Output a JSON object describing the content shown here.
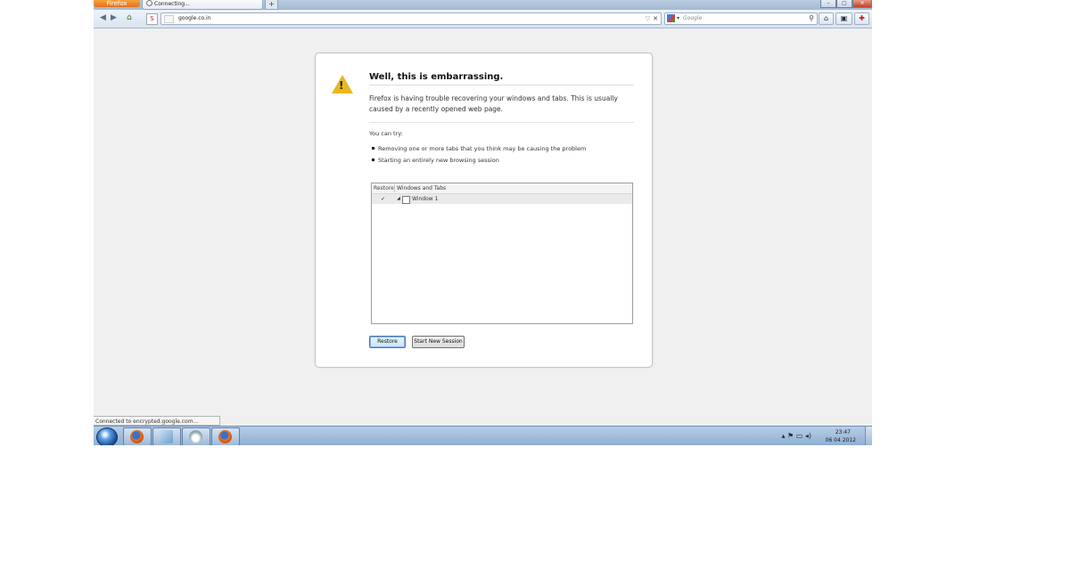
{
  "browser": {
    "menu_button": "Firefox",
    "tab_title": "Connecting...",
    "new_tab": "+",
    "window_controls": {
      "minimize": "–",
      "maximize": "▢",
      "close": "✕"
    }
  },
  "navbar": {
    "url": "google.co.in",
    "search_placeholder": "Google",
    "icons": [
      "back-icon",
      "forward-icon",
      "home-icon",
      "search-icon"
    ]
  },
  "dialog": {
    "title": "Well, this is embarrassing.",
    "message": "Firefox is having trouble recovering your windows and tabs. This is usually caused by a recently opened web page.",
    "you_can_try": "You can try:",
    "suggestions": [
      "Removing one or more tabs that you think may be causing the problem",
      "Starting an entirely new browsing session"
    ],
    "tree": {
      "col_restore": "Restore",
      "col_windows_tabs": "Windows and Tabs",
      "rows": [
        {
          "checked": true,
          "label": "Window 1"
        }
      ]
    },
    "buttons": {
      "restore": "Restore",
      "new_session": "Start New Session"
    }
  },
  "status_bar": {
    "text": "Connected to encrypted.google.com..."
  },
  "taskbar": {
    "clock_time": "23:47",
    "clock_date": "06 04 2012",
    "tray_icons": "▴ ⚑ ▭ ◂)"
  }
}
